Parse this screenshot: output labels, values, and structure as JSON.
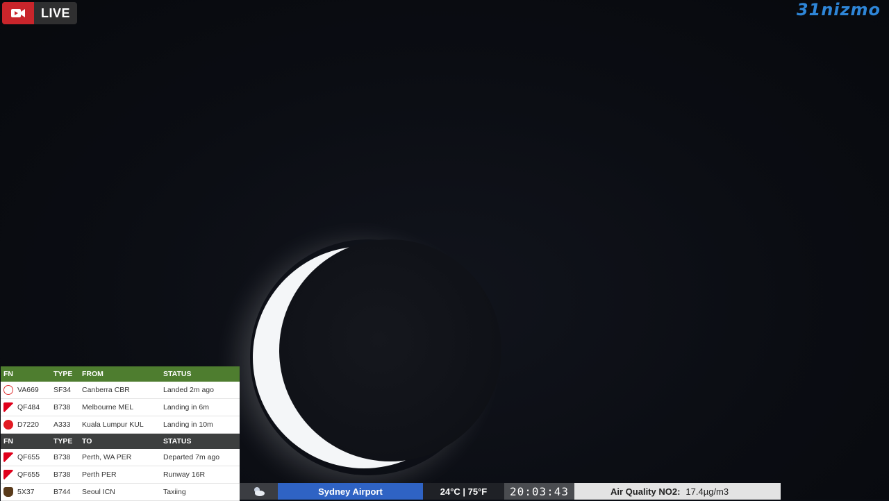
{
  "overlay": {
    "live_label": "LIVE",
    "live_icon": "camera-icon",
    "brand": "31nizmo"
  },
  "flights": {
    "arrivals_header": {
      "fn": "FN",
      "type": "TYPE",
      "loc": "FROM",
      "status": "STATUS"
    },
    "arrivals": [
      {
        "airline_icon": "virgin-australia-icon",
        "fn": "VA669",
        "type": "SF34",
        "loc": "Canberra CBR",
        "status": "Landed 2m ago"
      },
      {
        "airline_icon": "qantas-icon",
        "fn": "QF484",
        "type": "B738",
        "loc": "Melbourne MEL",
        "status": "Landing in 6m"
      },
      {
        "airline_icon": "airasia-icon",
        "fn": "D7220",
        "type": "A333",
        "loc": "Kuala Lumpur KUL",
        "status": "Landing in 10m"
      }
    ],
    "departures_header": {
      "fn": "FN",
      "type": "TYPE",
      "loc": "TO",
      "status": "STATUS"
    },
    "departures": [
      {
        "airline_icon": "qantas-icon",
        "fn": "QF655",
        "type": "B738",
        "loc": "Perth, WA PER",
        "status": "Departed 7m ago"
      },
      {
        "airline_icon": "qantas-icon",
        "fn": "QF655",
        "type": "B738",
        "loc": "Perth PER",
        "status": "Runway 16R"
      },
      {
        "airline_icon": "ups-icon",
        "fn": "5X37",
        "type": "B744",
        "loc": "Seoul ICN",
        "status": "Taxiing"
      }
    ]
  },
  "status_bar": {
    "weather_icon": "partly-cloudy-night-icon",
    "location": "Sydney Airport",
    "temperature": "24°C | 75°F",
    "time": "20:03:43",
    "air_quality_label": "Air Quality NO2:",
    "air_quality_value": "17.4µg/m3"
  },
  "colors": {
    "live_red": "#c9252b",
    "arrivals_header_green": "#4e7d2f",
    "departures_header_dark": "#3d3f3f",
    "location_blue": "#2f63c4",
    "brand_blue": "#2e86d8"
  }
}
